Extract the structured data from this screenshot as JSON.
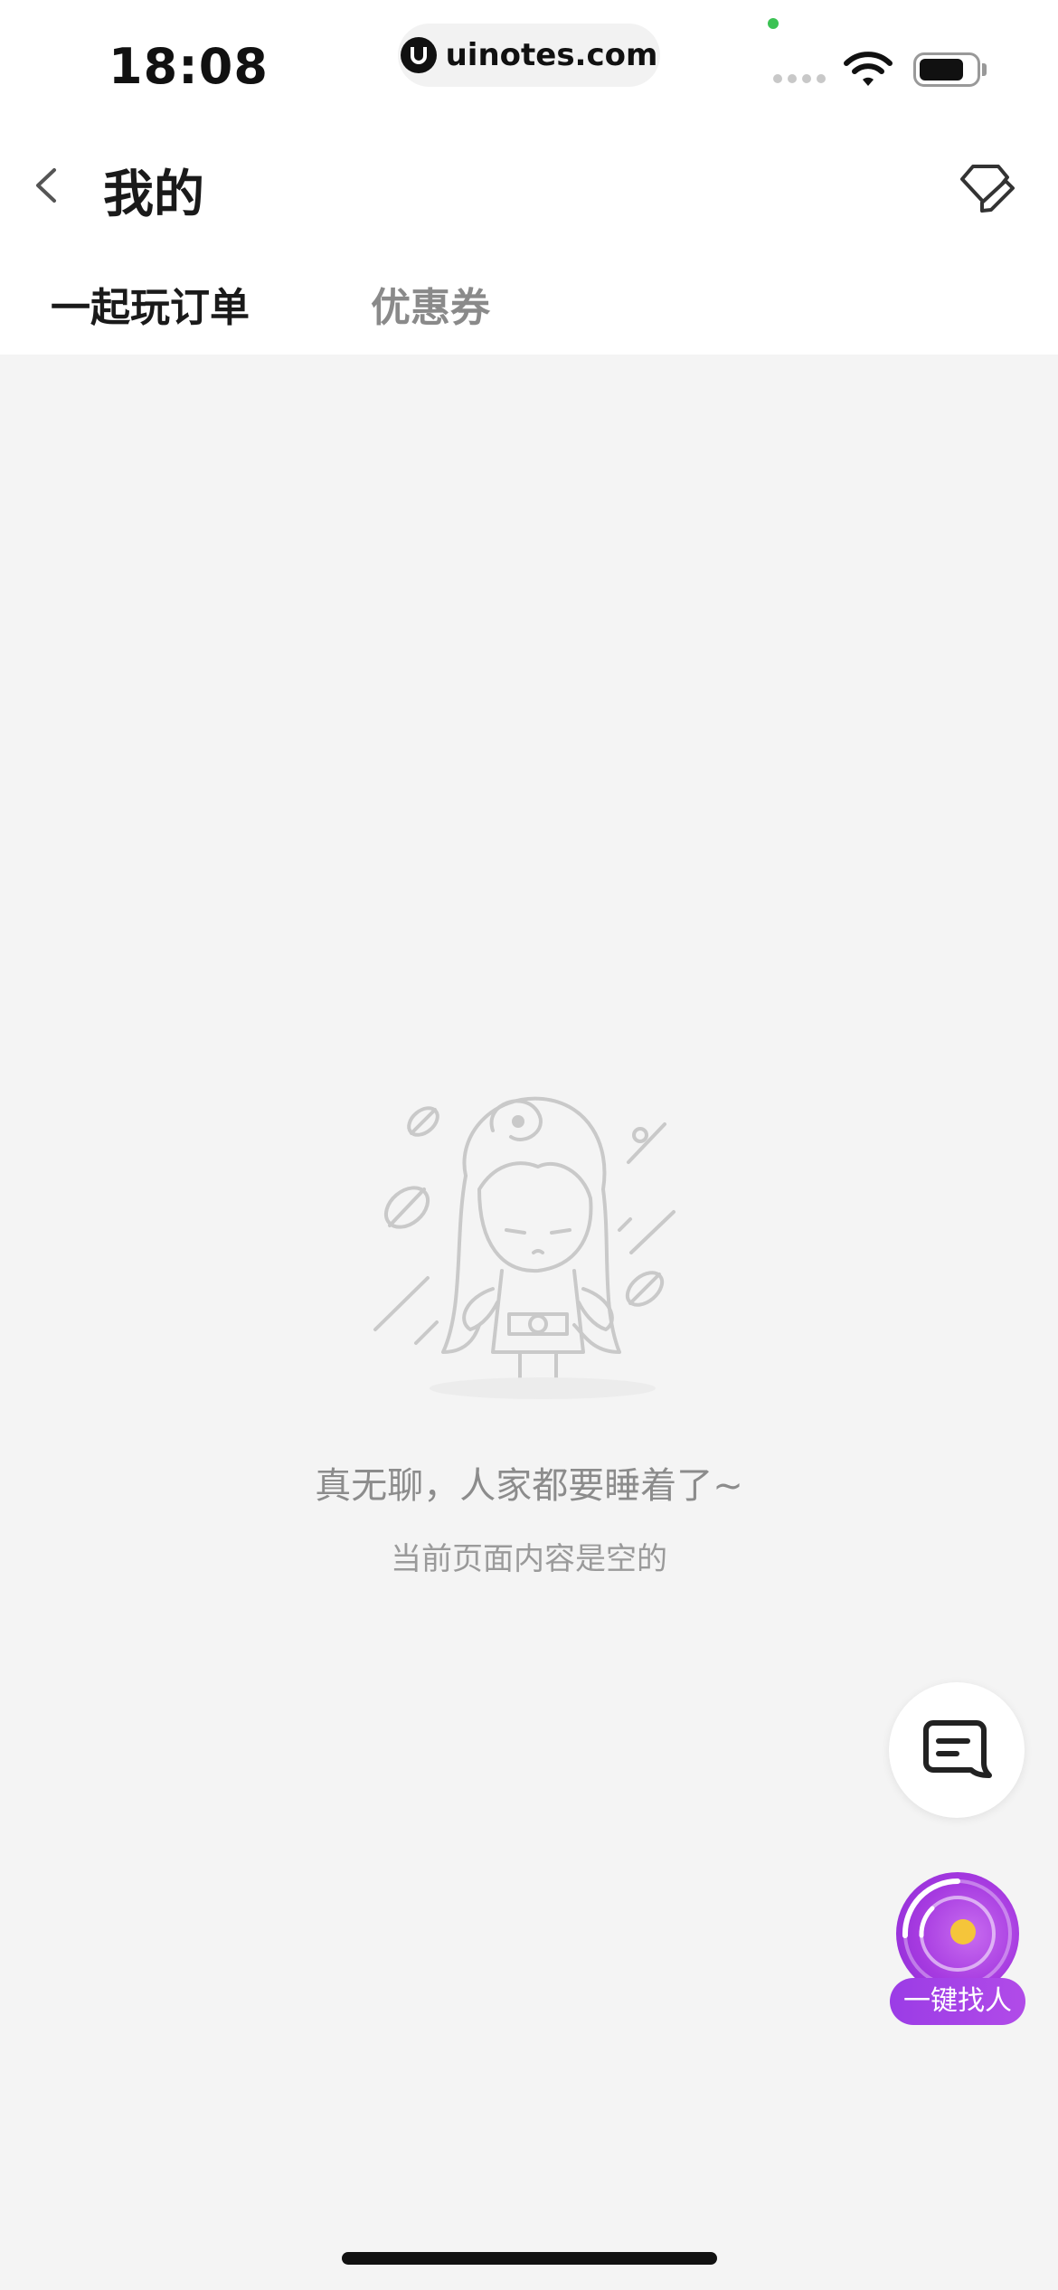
{
  "status_bar": {
    "time": "18:08",
    "url": "uinotes.com"
  },
  "header": {
    "title": "我的",
    "back_icon": "chevron-left-icon",
    "action_icon": "edit-tag-icon"
  },
  "tabs": [
    {
      "label": "一起玩订单",
      "active": true
    },
    {
      "label": "优惠券",
      "active": false
    }
  ],
  "empty_state": {
    "illustration_icon": "sleepy-character-illustration",
    "title": "真无聊，人家都要睡着了~",
    "subtitle": "当前页面内容是空的"
  },
  "floating": {
    "note_icon": "note-icon",
    "find_button_label": "一键找人",
    "find_icon": "radar-icon"
  },
  "colors": {
    "background": "#f4f4f4",
    "accent_purple": "#a63ae0",
    "radar_dot": "#f5c53a"
  }
}
